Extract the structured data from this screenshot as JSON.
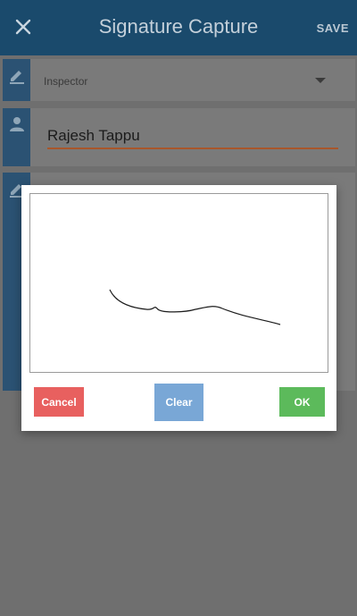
{
  "app_bar": {
    "title": "Signature Capture",
    "save_label": "SAVE"
  },
  "form": {
    "role_dropdown": {
      "selected": "Inspector"
    },
    "name_field": {
      "value": "Rajesh Tappu"
    }
  },
  "signature_dialog": {
    "cancel_label": "Cancel",
    "clear_label": "Clear",
    "ok_label": "OK"
  },
  "colors": {
    "app_bar": "#1a4a6c",
    "field_underline": "#a8562b",
    "cancel": "#e8605f",
    "clear": "#79a7d6",
    "ok": "#5cba5b"
  },
  "icons": [
    "close-icon",
    "edit-pencil-icon",
    "person-icon",
    "dropdown-arrow-icon"
  ]
}
